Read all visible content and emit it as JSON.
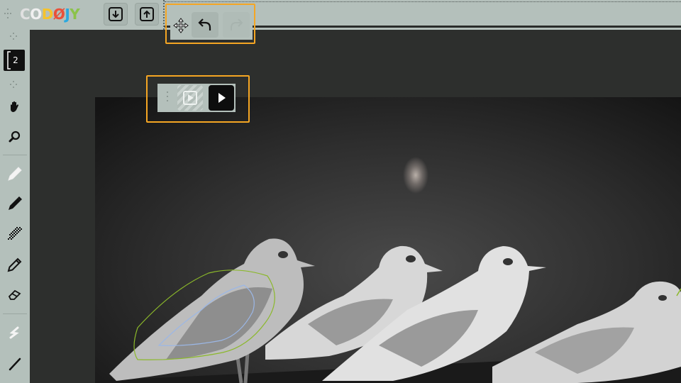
{
  "app": {
    "logo_letters": [
      "C",
      "O",
      "D",
      "Ø",
      "J",
      "Y"
    ],
    "logo_colors": [
      "#e0e0e0",
      "#f0f0f0",
      "#f6c32c",
      "#e9503a",
      "#2aa8e0",
      "#8bc34a"
    ]
  },
  "toolbar": {
    "save_icon": "download-icon",
    "open_icon": "upload-icon"
  },
  "history": {
    "move_icon": "move-icon",
    "undo_icon": "undo-icon",
    "redo_icon": "redo-icon",
    "redo_enabled": false
  },
  "sidebar": {
    "brush_size": "2",
    "tools": [
      {
        "name": "hand-icon"
      },
      {
        "name": "zoom-icon"
      },
      {
        "name": "pen-icon"
      },
      {
        "name": "marker-icon"
      },
      {
        "name": "dither-brush-icon"
      },
      {
        "name": "pencil-icon"
      },
      {
        "name": "eraser-icon"
      },
      {
        "name": "smudge-icon"
      },
      {
        "name": "line-icon"
      }
    ]
  },
  "player": {
    "frame_play_icon": "play-frame-icon",
    "play_icon": "play-icon"
  },
  "colors": {
    "panel": "#b4c0bb",
    "workspace": "#2d2f2d",
    "highlight": "#f5a623",
    "stroke_green": "#8bb82a",
    "stroke_blue": "#9bb7e6"
  }
}
